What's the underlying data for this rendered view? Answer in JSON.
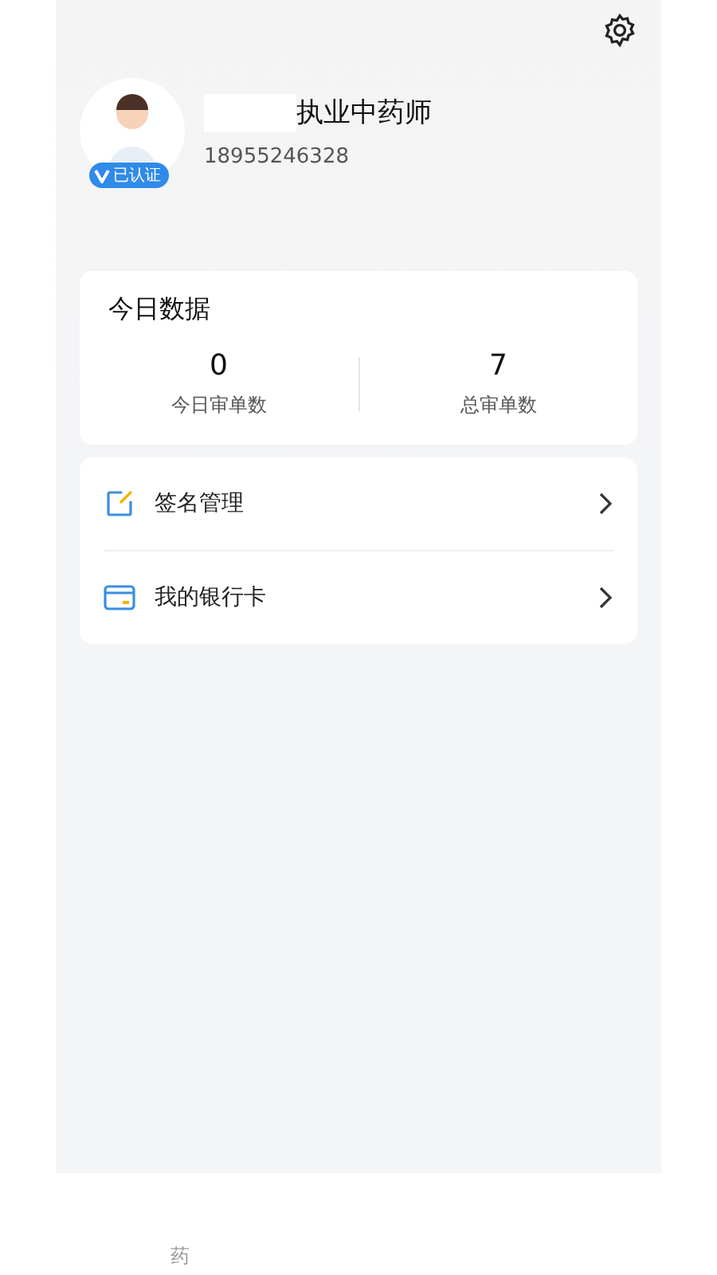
{
  "profile": {
    "badge": "已认证",
    "title": "执业中药师",
    "phone": "18955246328"
  },
  "today_stats": {
    "title": "今日数据",
    "stats": [
      {
        "value": "0",
        "label": "今日审单数"
      },
      {
        "value": "7",
        "label": "总审单数"
      }
    ]
  },
  "menu": [
    {
      "kind": "signature",
      "label": "签名管理"
    },
    {
      "kind": "bank-card",
      "label": "我的银行卡"
    }
  ],
  "tab_bar": {
    "tabs": [
      {
        "label": "药",
        "selected": false
      }
    ]
  }
}
